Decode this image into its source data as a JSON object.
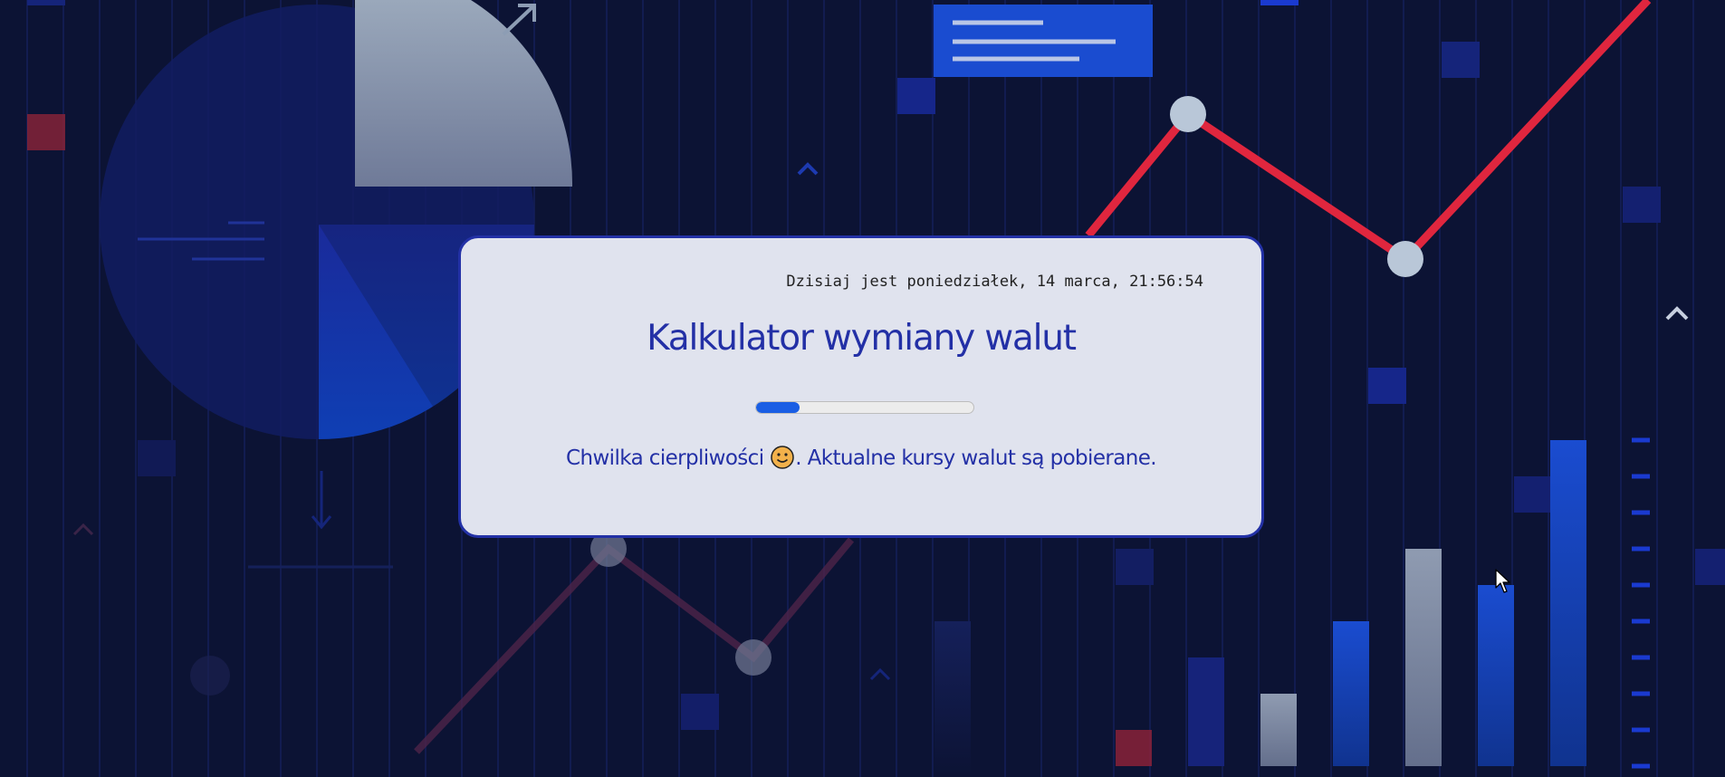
{
  "header": {
    "date_text": "Dzisiaj jest poniedziałek, 14 marca, 21:56:54"
  },
  "main": {
    "title": "Kalkulator wymiany walut",
    "progress_fraction": 0.2,
    "message_before": "Chwilka cierpliwości",
    "message_icon": "smiley-face-icon",
    "message_after": ". Aktualne kursy walut są pobierane."
  },
  "colors": {
    "background": "#0c1334",
    "card": "#e0e3ee",
    "card_border": "#2331a6",
    "title": "#2330a6",
    "progress": "#1a5ee4",
    "accent_red": "#e0263e"
  }
}
